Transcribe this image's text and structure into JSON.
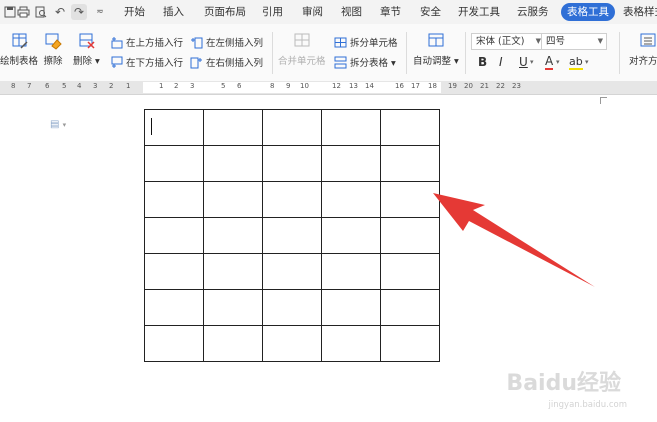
{
  "menubar": {
    "tabs": [
      "开始",
      "插入",
      "页面布局",
      "引用",
      "审阅",
      "视图",
      "章节",
      "安全",
      "开发工具",
      "云服务",
      "表格工具",
      "表格样式"
    ],
    "active_tab": "表格工具"
  },
  "ribbon": {
    "draw_table": "绘制表格",
    "erase": "擦除",
    "delete": "删除",
    "insert_above": "在上方插入行",
    "insert_below": "在下方插入行",
    "insert_left": "在左侧插入列",
    "insert_right": "在右侧插入列",
    "merge_cells": "合并单元格",
    "split_cells": "拆分单元格",
    "split_table": "拆分表格",
    "auto_fit": "自动调整",
    "font_family": "宋体 (正文)",
    "font_size": "四号",
    "bold": "B",
    "italic": "I",
    "underline": "U",
    "font_color": "A",
    "highlight": "ab",
    "align": "对齐方式"
  },
  "ruler": {
    "left_ticks": [
      "8",
      "7",
      "6",
      "5",
      "4",
      "3",
      "2",
      "1"
    ],
    "table_ticks": [
      "1",
      "2",
      "3",
      "5",
      "6",
      "8",
      "9",
      "10",
      "12",
      "13",
      "14",
      "16",
      "17",
      "18",
      "19",
      "20",
      "21",
      "22",
      "23"
    ]
  },
  "table": {
    "rows": 7,
    "cols": 5
  },
  "colors": {
    "accent": "#2f6fd6",
    "arrow": "#e53935",
    "border": "#222222"
  },
  "watermark": {
    "brand": "Baidu经验",
    "url": "jingyan.baidu.com"
  }
}
